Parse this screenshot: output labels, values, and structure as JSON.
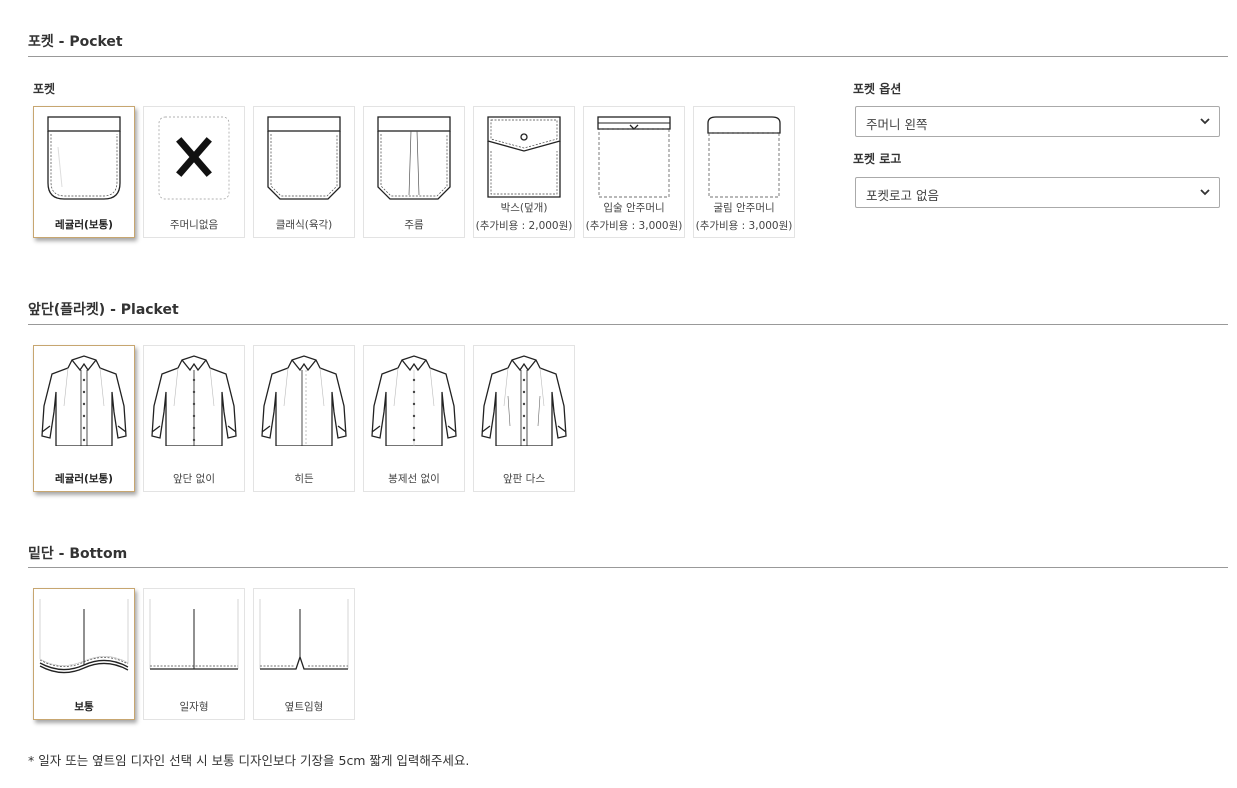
{
  "pocket": {
    "section_title": "포켓 - Pocket",
    "sub_label": "포켓",
    "options_label": "포켓 옵션",
    "options_value": "주머니 왼쪽",
    "logo_label": "포켓 로고",
    "logo_value": "포켓로고 없음",
    "items": [
      {
        "line1": "레귤러(보통)",
        "line2": "",
        "icon": "regular-pocket-icon",
        "selected": true
      },
      {
        "line1": "주머니없음",
        "line2": "",
        "icon": "no-pocket-icon",
        "selected": false
      },
      {
        "line1": "클래식(육각)",
        "line2": "",
        "icon": "classic-hexagon-pocket-icon",
        "selected": false
      },
      {
        "line1": "주름",
        "line2": "",
        "icon": "pleated-pocket-icon",
        "selected": false
      },
      {
        "line1": "박스(덮개)",
        "line2": "(추가비용 : 2,000원)",
        "icon": "box-flap-pocket-icon",
        "selected": false
      },
      {
        "line1": "입술 안주머니",
        "line2": "(추가비용 : 3,000원)",
        "icon": "welt-inner-pocket-icon",
        "selected": false
      },
      {
        "line1": "굴림 안주머니",
        "line2": "(추가비용 : 3,000원)",
        "icon": "rounded-inner-pocket-icon",
        "selected": false
      }
    ]
  },
  "placket": {
    "section_title": "앞단(플라켓) - Placket",
    "items": [
      {
        "label": "레귤러(보통)",
        "icon": "regular-placket-shirt-icon",
        "selected": true
      },
      {
        "label": "앞단 없이",
        "icon": "no-placket-shirt-icon",
        "selected": false
      },
      {
        "label": "히든",
        "icon": "hidden-placket-shirt-icon",
        "selected": false
      },
      {
        "label": "봉제선 없이",
        "icon": "seamless-placket-shirt-icon",
        "selected": false
      },
      {
        "label": "앞판 다스",
        "icon": "front-dart-shirt-icon",
        "selected": false
      }
    ]
  },
  "bottom": {
    "section_title": "밑단 - Bottom",
    "items": [
      {
        "label": "보통",
        "icon": "curved-hem-icon",
        "selected": true
      },
      {
        "label": "일자형",
        "icon": "straight-hem-icon",
        "selected": false
      },
      {
        "label": "옆트임형",
        "icon": "side-slit-hem-icon",
        "selected": false
      }
    ]
  },
  "note": "* 일자 또는 옆트임 디자인 선택 시 보통 디자인보다 기장을 5cm 짧게 입력해주세요.",
  "colors": {
    "accent_border": "#c7a670",
    "divider": "#999999",
    "text": "#333333"
  }
}
